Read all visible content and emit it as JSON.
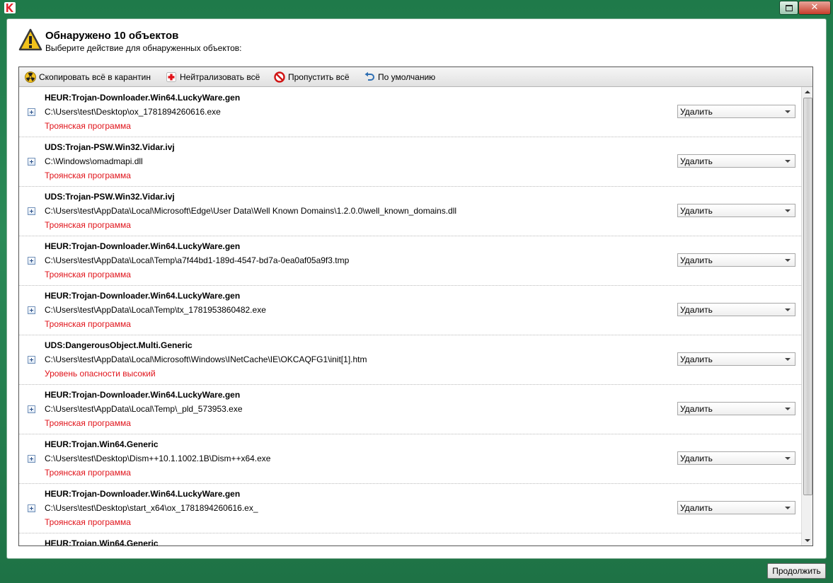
{
  "window": {
    "close_glyph": "✕"
  },
  "header": {
    "title": "Обнаружено 10 объектов",
    "subtitle": "Выберите действие для обнаруженных объектов:"
  },
  "toolbar": {
    "quarantine_all": "Скопировать всё в карантин",
    "disinfect_all": "Нейтрализовать всё",
    "skip_all": "Пропустить всё",
    "default": "По умолчанию"
  },
  "detections": [
    {
      "name": "HEUR:Trojan-Downloader.Win64.LuckyWare.gen",
      "path": "C:\\Users\\test\\Desktop\\ox_1781894260616.exe",
      "type": "Троянская программа",
      "action": "Удалить"
    },
    {
      "name": "UDS:Trojan-PSW.Win32.Vidar.ivj",
      "path": "C:\\Windows\\omadmapi.dll",
      "type": "Троянская программа",
      "action": "Удалить"
    },
    {
      "name": "UDS:Trojan-PSW.Win32.Vidar.ivj",
      "path": "C:\\Users\\test\\AppData\\Local\\Microsoft\\Edge\\User Data\\Well Known Domains\\1.2.0.0\\well_known_domains.dll",
      "type": "Троянская программа",
      "action": "Удалить"
    },
    {
      "name": "HEUR:Trojan-Downloader.Win64.LuckyWare.gen",
      "path": "C:\\Users\\test\\AppData\\Local\\Temp\\a7f44bd1-189d-4547-bd7a-0ea0af05a9f3.tmp",
      "type": "Троянская программа",
      "action": "Удалить"
    },
    {
      "name": "HEUR:Trojan-Downloader.Win64.LuckyWare.gen",
      "path": "C:\\Users\\test\\AppData\\Local\\Temp\\tx_1781953860482.exe",
      "type": "Троянская программа",
      "action": "Удалить"
    },
    {
      "name": "UDS:DangerousObject.Multi.Generic",
      "path": "C:\\Users\\test\\AppData\\Local\\Microsoft\\Windows\\INetCache\\IE\\OKCAQFG1\\init[1].htm",
      "type": "Уровень опасности высокий",
      "action": "Удалить"
    },
    {
      "name": "HEUR:Trojan-Downloader.Win64.LuckyWare.gen",
      "path": "C:\\Users\\test\\AppData\\Local\\Temp\\_pld_573953.exe",
      "type": "Троянская программа",
      "action": "Удалить"
    },
    {
      "name": "HEUR:Trojan.Win64.Generic",
      "path": "C:\\Users\\test\\Desktop\\Dism++10.1.1002.1B\\Dism++x64.exe",
      "type": "Троянская программа",
      "action": "Удалить"
    },
    {
      "name": "HEUR:Trojan-Downloader.Win64.LuckyWare.gen",
      "path": "C:\\Users\\test\\Desktop\\start_x64\\ox_1781894260616.ex_",
      "type": "Троянская программа",
      "action": "Удалить"
    },
    {
      "name": "HEUR:Trojan.Win64.Generic",
      "path": "",
      "type": "",
      "action": ""
    }
  ],
  "footer": {
    "continue_label": "Продолжить"
  },
  "colors": {
    "frame_green": "#2a8a57",
    "threat_red": "#e0131a"
  },
  "icons": {
    "app": "kaspersky-logo-icon",
    "header": "warning-icon",
    "quarantine": "radiation-icon",
    "disinfect": "red-cross-icon",
    "skip": "no-entry-icon",
    "default": "undo-arrow-icon"
  }
}
